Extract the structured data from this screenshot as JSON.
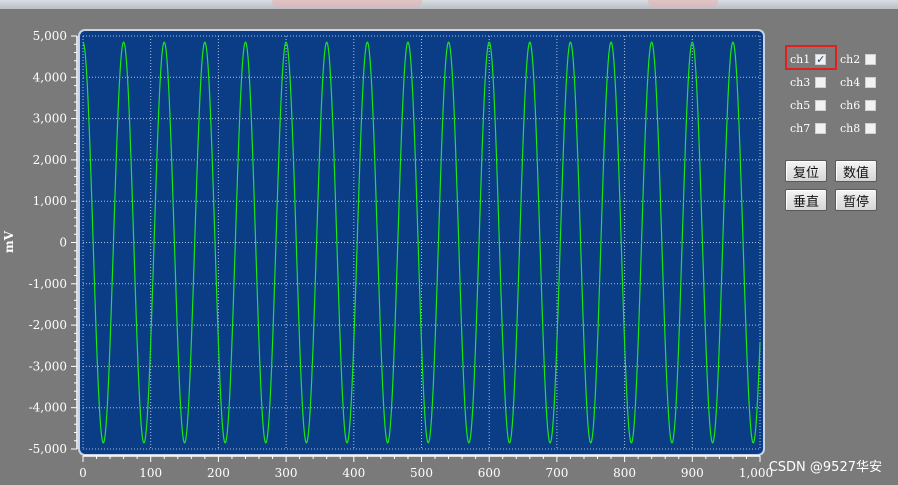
{
  "chart_data": {
    "type": "line",
    "title": "",
    "xlabel": "",
    "ylabel": "mV",
    "xlim": [
      0,
      1000
    ],
    "ylim": [
      -5000,
      5000
    ],
    "x_ticks": [
      "0",
      "100",
      "200",
      "300",
      "400",
      "500",
      "600",
      "700",
      "800",
      "900",
      "1,000"
    ],
    "y_ticks": [
      "5,000",
      "4,000",
      "3,000",
      "2,000",
      "1,000",
      "0",
      "-1,000",
      "-2,000",
      "-3,000",
      "-4,000",
      "-5,000"
    ],
    "grid": true,
    "series": [
      {
        "color": "#19e619",
        "function": "sine",
        "amplitude": 4850,
        "period": 60,
        "phase_x_at_peak": 0
      }
    ]
  },
  "colors": {
    "plot_bg": "#0a3d86",
    "window_bg": "#7a7a7a",
    "series": "#19e619",
    "highlight": "#e02020"
  },
  "channels": [
    {
      "label": "ch1",
      "checked": true
    },
    {
      "label": "ch2",
      "checked": false
    },
    {
      "label": "ch3",
      "checked": false
    },
    {
      "label": "ch4",
      "checked": false
    },
    {
      "label": "ch5",
      "checked": false
    },
    {
      "label": "ch6",
      "checked": false
    },
    {
      "label": "ch7",
      "checked": false
    },
    {
      "label": "ch8",
      "checked": false
    }
  ],
  "buttons": {
    "reset": "复位",
    "value": "数值",
    "vertical": "垂直",
    "pause": "暂停"
  },
  "watermark": "CSDN @9527华安"
}
